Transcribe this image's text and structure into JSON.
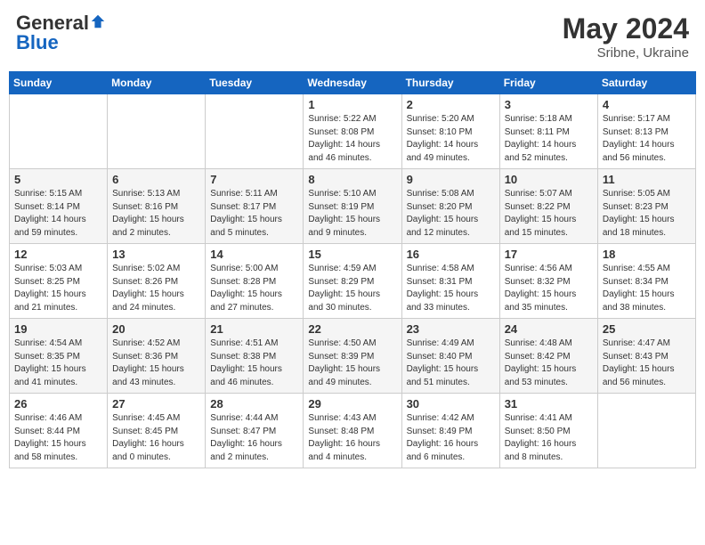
{
  "header": {
    "logo_general": "General",
    "logo_blue": "Blue",
    "month_year": "May 2024",
    "location": "Sribne, Ukraine"
  },
  "days_of_week": [
    "Sunday",
    "Monday",
    "Tuesday",
    "Wednesday",
    "Thursday",
    "Friday",
    "Saturday"
  ],
  "weeks": [
    [
      {
        "day": "",
        "info": ""
      },
      {
        "day": "",
        "info": ""
      },
      {
        "day": "",
        "info": ""
      },
      {
        "day": "1",
        "info": "Sunrise: 5:22 AM\nSunset: 8:08 PM\nDaylight: 14 hours\nand 46 minutes."
      },
      {
        "day": "2",
        "info": "Sunrise: 5:20 AM\nSunset: 8:10 PM\nDaylight: 14 hours\nand 49 minutes."
      },
      {
        "day": "3",
        "info": "Sunrise: 5:18 AM\nSunset: 8:11 PM\nDaylight: 14 hours\nand 52 minutes."
      },
      {
        "day": "4",
        "info": "Sunrise: 5:17 AM\nSunset: 8:13 PM\nDaylight: 14 hours\nand 56 minutes."
      }
    ],
    [
      {
        "day": "5",
        "info": "Sunrise: 5:15 AM\nSunset: 8:14 PM\nDaylight: 14 hours\nand 59 minutes."
      },
      {
        "day": "6",
        "info": "Sunrise: 5:13 AM\nSunset: 8:16 PM\nDaylight: 15 hours\nand 2 minutes."
      },
      {
        "day": "7",
        "info": "Sunrise: 5:11 AM\nSunset: 8:17 PM\nDaylight: 15 hours\nand 5 minutes."
      },
      {
        "day": "8",
        "info": "Sunrise: 5:10 AM\nSunset: 8:19 PM\nDaylight: 15 hours\nand 9 minutes."
      },
      {
        "day": "9",
        "info": "Sunrise: 5:08 AM\nSunset: 8:20 PM\nDaylight: 15 hours\nand 12 minutes."
      },
      {
        "day": "10",
        "info": "Sunrise: 5:07 AM\nSunset: 8:22 PM\nDaylight: 15 hours\nand 15 minutes."
      },
      {
        "day": "11",
        "info": "Sunrise: 5:05 AM\nSunset: 8:23 PM\nDaylight: 15 hours\nand 18 minutes."
      }
    ],
    [
      {
        "day": "12",
        "info": "Sunrise: 5:03 AM\nSunset: 8:25 PM\nDaylight: 15 hours\nand 21 minutes."
      },
      {
        "day": "13",
        "info": "Sunrise: 5:02 AM\nSunset: 8:26 PM\nDaylight: 15 hours\nand 24 minutes."
      },
      {
        "day": "14",
        "info": "Sunrise: 5:00 AM\nSunset: 8:28 PM\nDaylight: 15 hours\nand 27 minutes."
      },
      {
        "day": "15",
        "info": "Sunrise: 4:59 AM\nSunset: 8:29 PM\nDaylight: 15 hours\nand 30 minutes."
      },
      {
        "day": "16",
        "info": "Sunrise: 4:58 AM\nSunset: 8:31 PM\nDaylight: 15 hours\nand 33 minutes."
      },
      {
        "day": "17",
        "info": "Sunrise: 4:56 AM\nSunset: 8:32 PM\nDaylight: 15 hours\nand 35 minutes."
      },
      {
        "day": "18",
        "info": "Sunrise: 4:55 AM\nSunset: 8:34 PM\nDaylight: 15 hours\nand 38 minutes."
      }
    ],
    [
      {
        "day": "19",
        "info": "Sunrise: 4:54 AM\nSunset: 8:35 PM\nDaylight: 15 hours\nand 41 minutes."
      },
      {
        "day": "20",
        "info": "Sunrise: 4:52 AM\nSunset: 8:36 PM\nDaylight: 15 hours\nand 43 minutes."
      },
      {
        "day": "21",
        "info": "Sunrise: 4:51 AM\nSunset: 8:38 PM\nDaylight: 15 hours\nand 46 minutes."
      },
      {
        "day": "22",
        "info": "Sunrise: 4:50 AM\nSunset: 8:39 PM\nDaylight: 15 hours\nand 49 minutes."
      },
      {
        "day": "23",
        "info": "Sunrise: 4:49 AM\nSunset: 8:40 PM\nDaylight: 15 hours\nand 51 minutes."
      },
      {
        "day": "24",
        "info": "Sunrise: 4:48 AM\nSunset: 8:42 PM\nDaylight: 15 hours\nand 53 minutes."
      },
      {
        "day": "25",
        "info": "Sunrise: 4:47 AM\nSunset: 8:43 PM\nDaylight: 15 hours\nand 56 minutes."
      }
    ],
    [
      {
        "day": "26",
        "info": "Sunrise: 4:46 AM\nSunset: 8:44 PM\nDaylight: 15 hours\nand 58 minutes."
      },
      {
        "day": "27",
        "info": "Sunrise: 4:45 AM\nSunset: 8:45 PM\nDaylight: 16 hours\nand 0 minutes."
      },
      {
        "day": "28",
        "info": "Sunrise: 4:44 AM\nSunset: 8:47 PM\nDaylight: 16 hours\nand 2 minutes."
      },
      {
        "day": "29",
        "info": "Sunrise: 4:43 AM\nSunset: 8:48 PM\nDaylight: 16 hours\nand 4 minutes."
      },
      {
        "day": "30",
        "info": "Sunrise: 4:42 AM\nSunset: 8:49 PM\nDaylight: 16 hours\nand 6 minutes."
      },
      {
        "day": "31",
        "info": "Sunrise: 4:41 AM\nSunset: 8:50 PM\nDaylight: 16 hours\nand 8 minutes."
      },
      {
        "day": "",
        "info": ""
      }
    ]
  ]
}
